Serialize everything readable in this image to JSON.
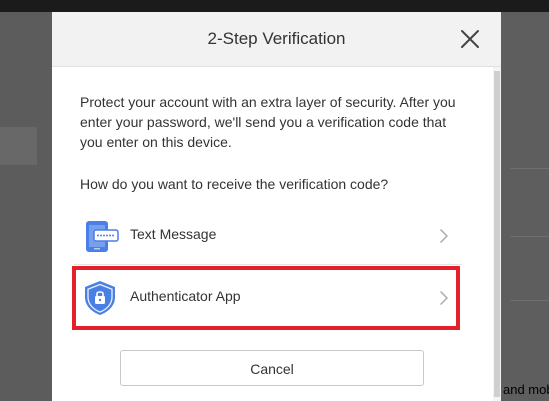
{
  "dialog": {
    "title": "2-Step Verification",
    "intro": "Protect your account with an extra layer of security. After you enter your password, we'll send you a verification code that you enter on this device.",
    "question": "How do you want to receive the verification code?",
    "options": [
      {
        "label": "Text Message",
        "icon": "phone-sms-icon"
      },
      {
        "label": "Authenticator App",
        "icon": "shield-lock-icon"
      }
    ],
    "cancel_label": "Cancel"
  },
  "background": {
    "partial_text": "and mob"
  },
  "colors": {
    "accent_blue": "#4a7fe6",
    "highlight_red": "#e3202c"
  }
}
